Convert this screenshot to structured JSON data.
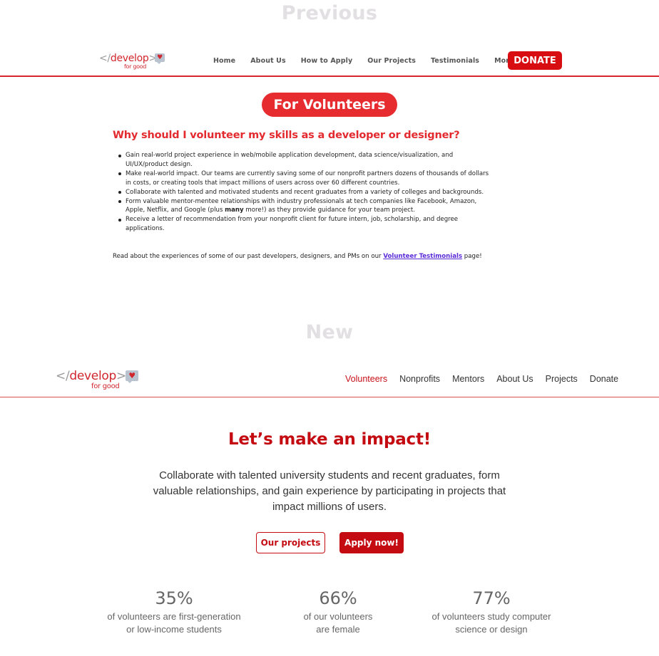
{
  "labels": {
    "previous": "Previous",
    "new": "New"
  },
  "logo": {
    "open_bracket": "</",
    "word": "develop",
    "close_bracket": ">",
    "tagline": "for good",
    "icon": "heart-speech-bubble-icon",
    "heart_glyph": "♥"
  },
  "colors": {
    "brand_red": "#d8272e",
    "new_red": "#c40b12",
    "link_purple": "#5b2bd8",
    "label_gray": "#e3e0e3"
  },
  "previous": {
    "nav": [
      {
        "label": "Home"
      },
      {
        "label": "About Us"
      },
      {
        "label": "How to Apply"
      },
      {
        "label": "Our Projects"
      },
      {
        "label": "Testimonials"
      },
      {
        "label": "More..."
      }
    ],
    "donate_label": "DONATE",
    "pill_title": "For Volunteers",
    "heading": "Why should I volunteer my skills as a developer or designer?",
    "bullets": [
      {
        "text": "Gain real-world project experience in web/mobile application development, data science/visualization, and UI/UX/product design."
      },
      {
        "text": "Make real-world impact. Our teams are currently saving some of our nonprofit partners dozens of thousands of dollars in costs, or creating tools that impact millions of users across over 60 different countries."
      },
      {
        "text": "Collaborate with talented and motivated students and recent graduates from a variety of colleges and backgrounds."
      },
      {
        "before": "Form valuable mentor-mentee relationships with industry professionals at tech companies like Facebook, Amazon, Apple, Netflix, and Google (plus ",
        "bold": "many",
        "after": " more!) as they provide guidance for your team project."
      },
      {
        "text": "Receive a letter of recommendation from your nonprofit client for future intern, job, scholarship, and degree applications."
      }
    ],
    "read_before": "Read about the experiences of some of our past developers, designers, and PMs on our ",
    "read_link": "Volunteer Testimonials",
    "read_after": " page!"
  },
  "new": {
    "nav": [
      {
        "label": "Volunteers",
        "active": true
      },
      {
        "label": "Nonprofits"
      },
      {
        "label": "Mentors"
      },
      {
        "label": "About Us"
      },
      {
        "label": "Projects"
      },
      {
        "label": "Donate"
      }
    ],
    "hero_title": "Let’s make an impact!",
    "hero_body": "Collaborate with talented university students and recent graduates, form valuable relationships, and gain experience by participating in projects that impact millions of users.",
    "buttons": {
      "projects": "Our projects",
      "apply": "Apply now!"
    },
    "stats": [
      {
        "value": "35%",
        "line1": "of volunteers are first-generation",
        "line2": "or low-income students"
      },
      {
        "value": "66%",
        "line1": "of our volunteers",
        "line2": "are female"
      },
      {
        "value": "77%",
        "line1": "of volunteers study computer",
        "line2": "science or design"
      }
    ]
  }
}
